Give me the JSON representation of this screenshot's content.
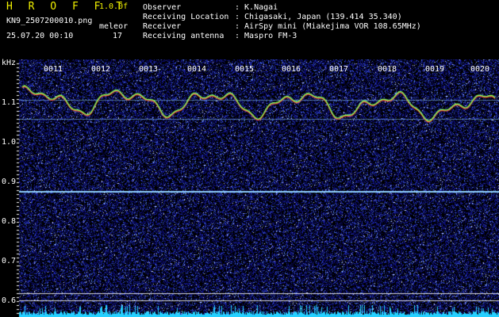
{
  "header": {
    "brand": "H R O F F T",
    "version": "1.0.0f",
    "filename": "KN9_2507200010.png",
    "meleor_label": "meleor",
    "datetime": "25.07.20 00:10",
    "meleor_count": "17",
    "fields": [
      {
        "label": "Observer",
        "value": ": K.Nagai"
      },
      {
        "label": "Receiving Location",
        "value": ": Chigasaki, Japan (139.414 35.340)"
      },
      {
        "label": "Receiver",
        "value": ": AirSpy mini (Miakejima VOR 108.65MHz)"
      },
      {
        "label": "Receiving antenna",
        "value": ": Maspro FM-3"
      }
    ]
  },
  "axis": {
    "unit": "kHz",
    "y_ticks": [
      "1.1",
      "1.0",
      "0.9",
      "0.8",
      "0.7",
      "0.6"
    ],
    "x_ticks": [
      "0011",
      "0012",
      "0013",
      "0014",
      "0015",
      "0016",
      "0017",
      "0018",
      "0019",
      "0020"
    ]
  },
  "colors": {
    "background": "#000000",
    "text": "#ffffff",
    "highlight_text": "#f0f000",
    "noise_dark": "#0a0a6e",
    "carrier_line": "#8fd0ff",
    "trace_red": "#ff4a3a",
    "trace_green": "#7cff5a",
    "bottom_band": "#25d0ff"
  }
}
